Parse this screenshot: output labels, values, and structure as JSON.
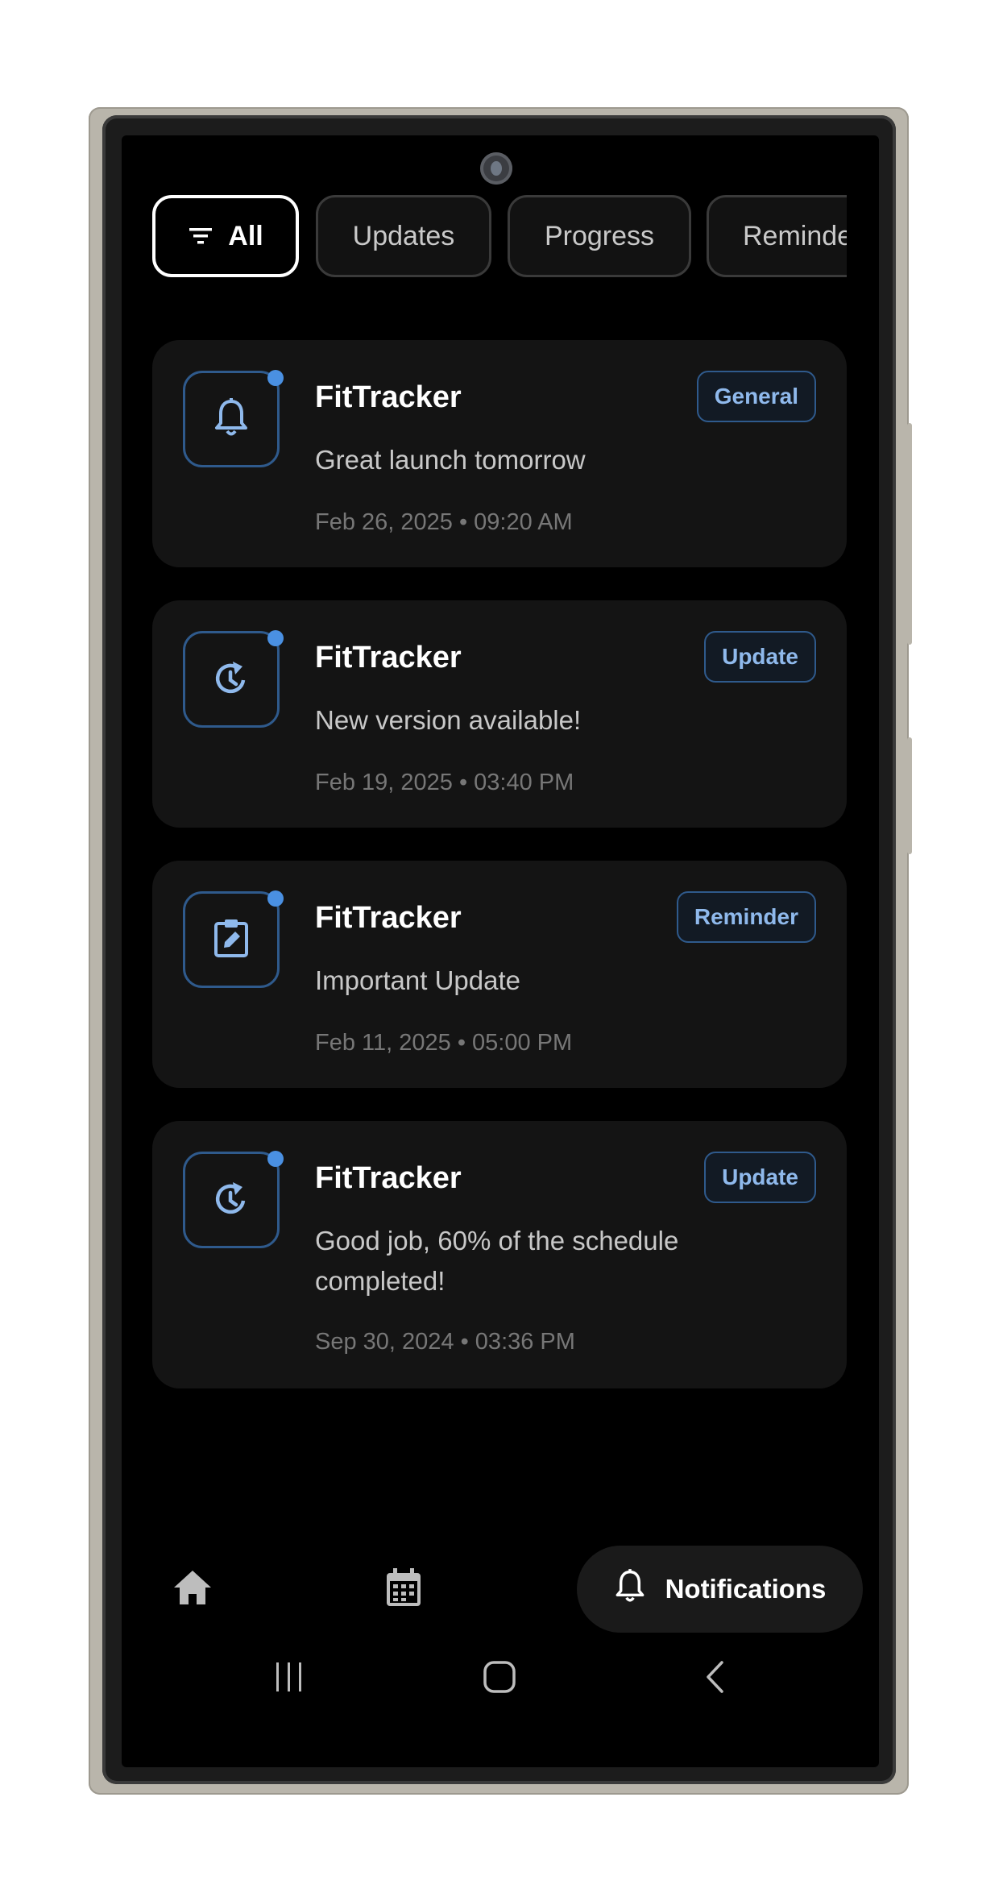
{
  "filters": {
    "items": [
      {
        "label": "All",
        "active": true
      },
      {
        "label": "Updates",
        "active": false
      },
      {
        "label": "Progress",
        "active": false
      },
      {
        "label": "Reminders",
        "active": false
      }
    ]
  },
  "notifications": [
    {
      "app": "FitTracker",
      "tag": "General",
      "message": "Great launch tomorrow",
      "time": "Feb 26, 2025 • 09:20 AM",
      "icon": "bell-icon",
      "unread": true
    },
    {
      "app": "FitTracker",
      "tag": "Update",
      "message": "New version available!",
      "time": "Feb 19, 2025 • 03:40 PM",
      "icon": "update-clock-icon",
      "unread": true
    },
    {
      "app": "FitTracker",
      "tag": "Reminder",
      "message": "Important Update",
      "time": "Feb 11, 2025 • 05:00 PM",
      "icon": "clipboard-edit-icon",
      "unread": true
    },
    {
      "app": "FitTracker",
      "tag": "Update",
      "message": "Good job, 60% of the schedule completed!",
      "time": "Sep 30, 2024 • 03:36 PM",
      "icon": "update-clock-icon",
      "unread": true
    }
  ],
  "bottom_nav": {
    "items": [
      {
        "icon": "home-icon"
      },
      {
        "icon": "calendar-icon"
      },
      {
        "icon": "bell-icon",
        "label": "Notifications",
        "active": true
      }
    ]
  },
  "system_nav": {
    "icons": [
      "recents-icon",
      "home-button-icon",
      "back-icon"
    ]
  },
  "colors": {
    "accent": "#4a90e2",
    "tag_text": "#8fb9ec",
    "background": "#000000",
    "card": "#141414"
  }
}
